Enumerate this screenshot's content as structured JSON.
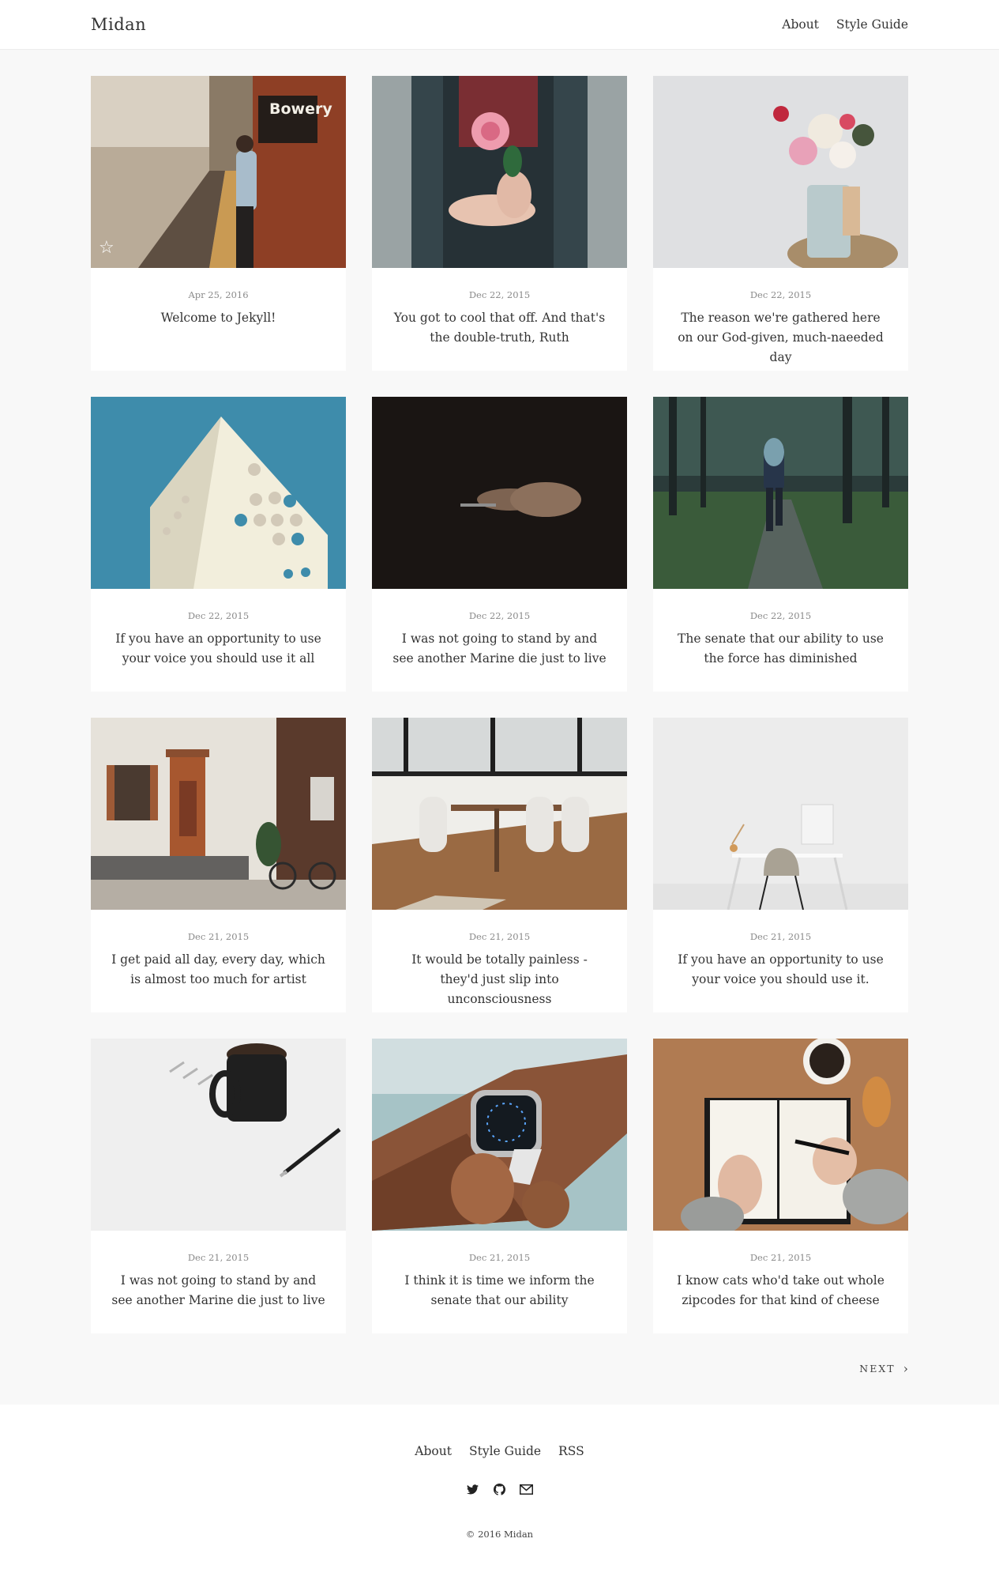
{
  "header": {
    "logo": "Midan",
    "nav": [
      {
        "label": "About"
      },
      {
        "label": "Style Guide"
      }
    ]
  },
  "posts": [
    {
      "date": "Apr 25, 2016",
      "title": "Welcome to Jekyll!",
      "image_text": "Bowery",
      "badge_icon": "star-outline-icon"
    },
    {
      "date": "Dec 22, 2015",
      "title": "You got to cool that off. And that's the double-truth, Ruth"
    },
    {
      "date": "Dec 22, 2015",
      "title": "The reason we're gathered here on our God-given, much-naeeded day"
    },
    {
      "date": "Dec 22, 2015",
      "title": "If you have an opportunity to use your voice you should use it all"
    },
    {
      "date": "Dec 22, 2015",
      "title": "I was not going to stand by and see another Marine die just to live"
    },
    {
      "date": "Dec 22, 2015",
      "title": "The senate that our ability to use the force has diminished"
    },
    {
      "date": "Dec 21, 2015",
      "title": "I get paid all day, every day, which is almost too much for artist"
    },
    {
      "date": "Dec 21, 2015",
      "title": "It would be totally painless - they'd just slip into unconsciousness"
    },
    {
      "date": "Dec 21, 2015",
      "title": "If you have an opportunity to use your voice you should use it."
    },
    {
      "date": "Dec 21, 2015",
      "title": "I was not going to stand by and see another Marine die just to live"
    },
    {
      "date": "Dec 21, 2015",
      "title": "I think it is time we inform the senate that our ability"
    },
    {
      "date": "Dec 21, 2015",
      "title": "I know cats who'd take out whole zipcodes for that kind of cheese"
    }
  ],
  "pagination": {
    "next_label": "NEXT",
    "next_icon": "chevron-right-icon"
  },
  "footer": {
    "nav": [
      {
        "label": "About"
      },
      {
        "label": "Style Guide"
      },
      {
        "label": "RSS"
      }
    ],
    "social_icons": [
      "twitter-icon",
      "github-icon",
      "email-icon"
    ],
    "copyright": "© 2016 Midan"
  }
}
